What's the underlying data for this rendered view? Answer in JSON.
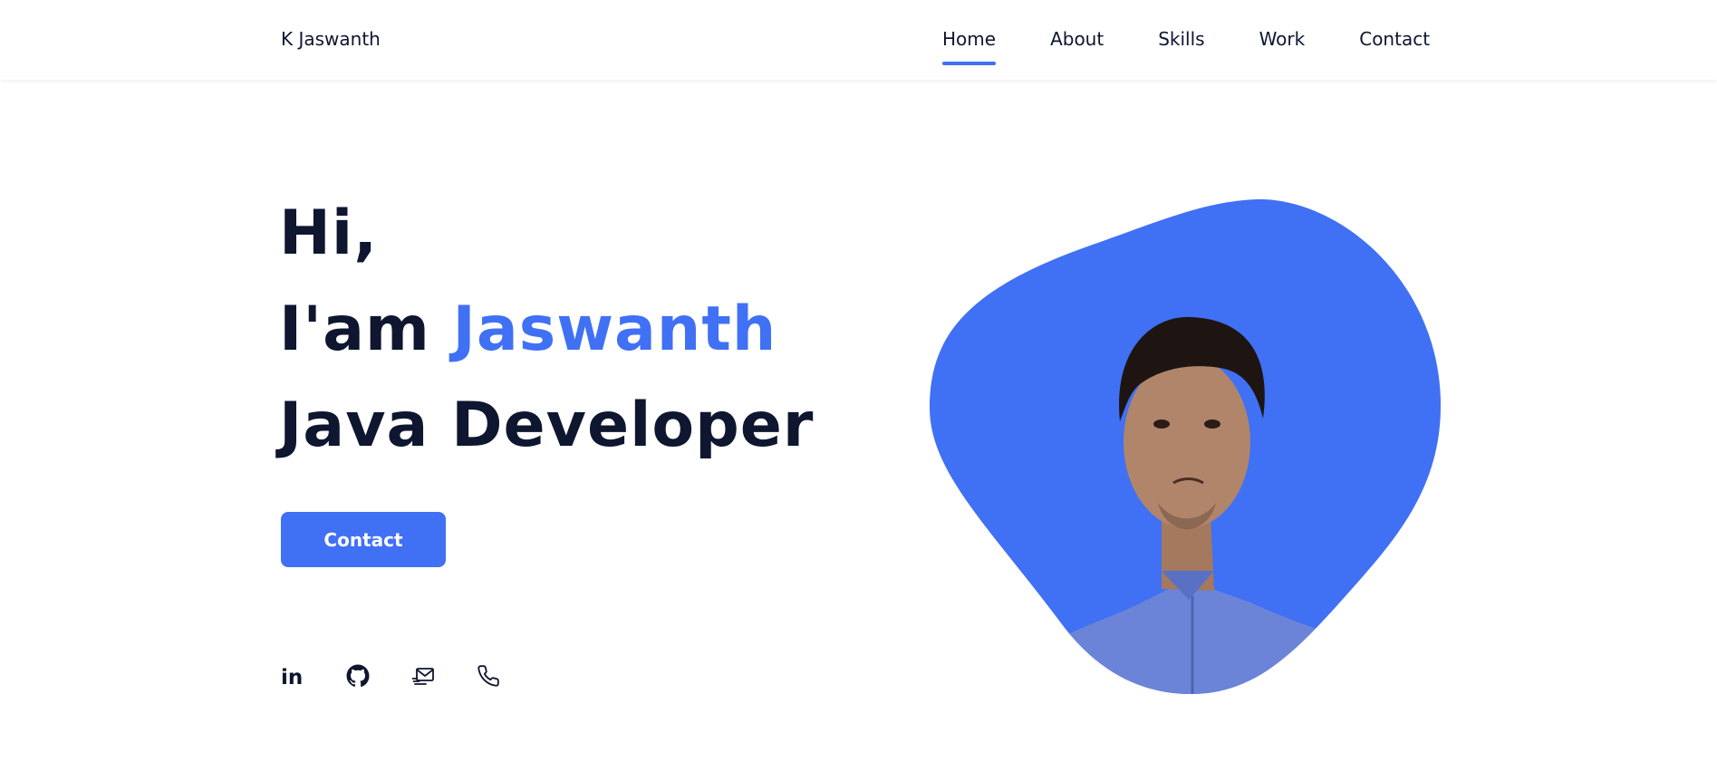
{
  "brand": {
    "name": "K Jaswanth"
  },
  "nav": {
    "items": [
      {
        "label": "Home",
        "active": true
      },
      {
        "label": "About",
        "active": false
      },
      {
        "label": "Skills",
        "active": false
      },
      {
        "label": "Work",
        "active": false
      },
      {
        "label": "Contact",
        "active": false
      }
    ]
  },
  "hero": {
    "greeting": "Hi,",
    "intro_prefix": "I'am ",
    "name": "Jaswanth",
    "role": "Java Developer",
    "cta_label": "Contact"
  },
  "social": {
    "icons": [
      "linkedin-icon",
      "github-icon",
      "mail-icon",
      "phone-icon"
    ],
    "linkedin_text": "in"
  },
  "colors": {
    "accent": "#4070f4",
    "text": "#0e1630",
    "background": "#ffffff"
  }
}
